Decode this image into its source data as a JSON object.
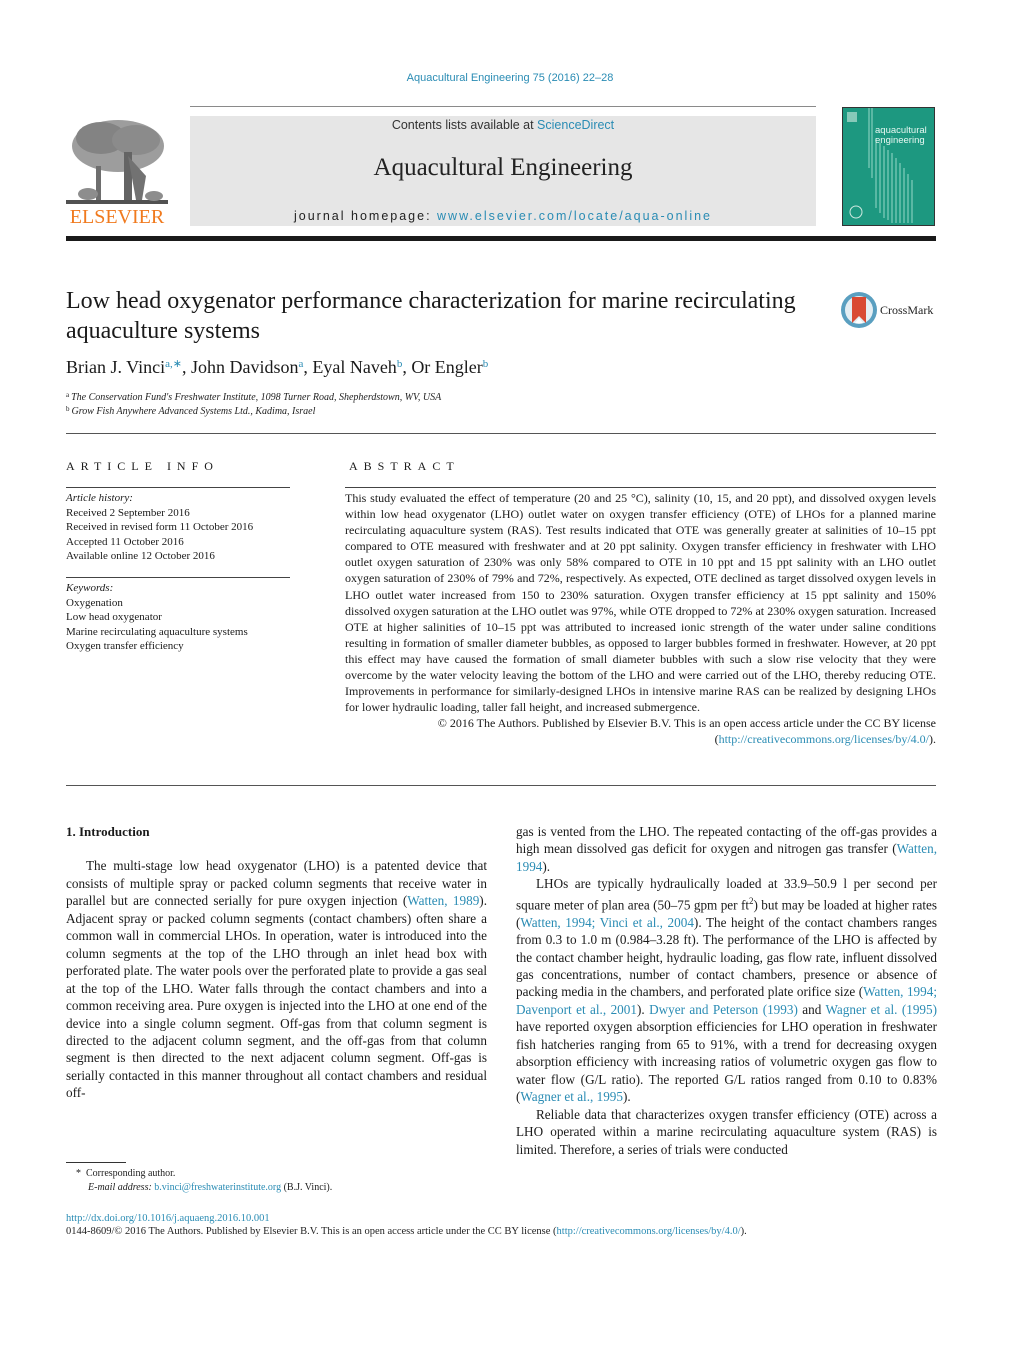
{
  "header": {
    "citation": "Aquacultural Engineering 75 (2016) 22–28",
    "contents_prefix": "Contents lists available at ",
    "contents_link": "ScienceDirect",
    "journal_name": "Aquacultural Engineering",
    "homepage_prefix": "journal homepage: ",
    "homepage_link": "www.elsevier.com/locate/aqua-online",
    "publisher_logo_text": "ELSEVIER",
    "cover_title_line1": "aquacultural",
    "cover_title_line2": "engineering",
    "colors": {
      "link": "#2a8cb4",
      "elsevier_orange": "#f07a1e",
      "cover_teal": "#1d9880"
    }
  },
  "article": {
    "title": "Low head oxygenator performance characterization for marine recirculating aquaculture systems",
    "crossmark_label": "CrossMark",
    "authors": [
      {
        "name": "Brian J. Vinci",
        "sup": "a,∗"
      },
      {
        "name": "John Davidson",
        "sup": "a"
      },
      {
        "name": "Eyal Naveh",
        "sup": "b"
      },
      {
        "name": "Or Engler",
        "sup": "b"
      }
    ],
    "affiliations": [
      {
        "key": "a",
        "text": "The Conservation Fund's Freshwater Institute, 1098 Turner Road, Shepherdstown, WV, USA"
      },
      {
        "key": "b",
        "text": "Grow Fish Anywhere Advanced Systems Ltd., Kadima, Israel"
      }
    ]
  },
  "article_info": {
    "heading": "ARTICLE INFO",
    "history_label": "Article history:",
    "history": [
      "Received 2 September 2016",
      "Received in revised form 11 October 2016",
      "Accepted 11 October 2016",
      "Available online 12 October 2016"
    ],
    "keywords_label": "Keywords:",
    "keywords": [
      "Oxygenation",
      "Low head oxygenator",
      "Marine recirculating aquaculture systems",
      "Oxygen transfer efficiency"
    ]
  },
  "abstract": {
    "heading": "ABSTRACT",
    "text": "This study evaluated the effect of temperature (20 and 25 °C), salinity (10, 15, and 20 ppt), and dissolved oxygen levels within low head oxygenator (LHO) outlet water on oxygen transfer efficiency (OTE) of LHOs for a planned marine recirculating aquaculture system (RAS). Test results indicated that OTE was generally greater at salinities of 10–15 ppt compared to OTE measured with freshwater and at 20 ppt salinity. Oxygen transfer efficiency in freshwater with LHO outlet oxygen saturation of 230% was only 58% compared to OTE in 10 ppt and 15 ppt salinity with an LHO outlet oxygen saturation of 230% of 79% and 72%, respectively. As expected, OTE declined as target dissolved oxygen levels in LHO outlet water increased from 150 to 230% saturation. Oxygen transfer efficiency at 15 ppt salinity and 150% dissolved oxygen saturation at the LHO outlet was 97%, while OTE dropped to 72% at 230% oxygen saturation. Increased OTE at higher salinities of 10–15 ppt was attributed to increased ionic strength of the water under saline conditions resulting in formation of smaller diameter bubbles, as opposed to larger bubbles formed in freshwater. However, at 20 ppt this effect may have caused the formation of small diameter bubbles with such a slow rise velocity that they were overcome by the water velocity leaving the bottom of the LHO and were carried out of the LHO, thereby reducing OTE. Improvements in performance for similarly-designed LHOs in intensive marine RAS can be realized by designing LHOs for lower hydraulic loading, taller fall height, and increased submergence.",
    "copyright": "© 2016 The Authors. Published by Elsevier B.V. This is an open access article under the CC BY license",
    "license_open": "(",
    "license_link": "http://creativecommons.org/licenses/by/4.0/",
    "license_close": ")."
  },
  "body": {
    "section_heading": "1.  Introduction",
    "p1": [
      {
        "t": "The multi-stage low head oxygenator (LHO) is a patented device that consists of multiple spray or packed column segments that receive water in parallel but are connected serially for pure oxygen injection ("
      },
      {
        "link": "Watten, 1989"
      },
      {
        "t": "). Adjacent spray or packed column segments (contact chambers) often share a common wall in commercial LHOs. In operation, water is introduced into the column segments at the top of the LHO through an inlet head box with perforated plate. The water pools over the perforated plate to provide a gas seal at the top of the LHO. Water falls through the contact chambers and into a common receiving area. Pure oxygen is injected into the LHO at one end of the device into a single column segment. Off-gas from that column segment is directed to the adjacent column segment, and the off-gas from that column segment is then directed to the next adjacent column segment. Off-gas is serially contacted in this manner throughout all contact chambers and residual off-"
      }
    ],
    "p1_cont": [
      {
        "t": "gas is vented from the LHO. The repeated contacting of the off-gas provides a high mean dissolved gas deficit for oxygen and nitrogen gas transfer ("
      },
      {
        "link": "Watten, 1994"
      },
      {
        "t": ")."
      }
    ],
    "p2": [
      {
        "t": "LHOs are typically hydraulically loaded at 33.9–50.9 l per second per square meter of plan area (50–75 gpm per ft"
      },
      {
        "sup": "2"
      },
      {
        "t": ") but may be loaded at higher rates ("
      },
      {
        "link": "Watten, 1994; Vinci et al., 2004"
      },
      {
        "t": "). The height of the contact chambers ranges from 0.3 to 1.0 m (0.984–3.28 ft). The performance of the LHO is affected by the contact chamber height, hydraulic loading, gas flow rate, influent dissolved gas concentrations, number of contact chambers, presence or absence of packing media in the chambers, and perforated plate orifice size ("
      },
      {
        "link": "Watten, 1994; Davenport et al., 2001"
      },
      {
        "t": "). "
      },
      {
        "link": "Dwyer and Peterson (1993)"
      },
      {
        "t": " and "
      },
      {
        "link": "Wagner et al. (1995)"
      },
      {
        "t": " have reported oxygen absorption efficiencies for LHO operation in freshwater fish hatcheries ranging from 65 to 91%, with a trend for decreasing oxygen absorption efficiency with increasing ratios of volumetric oxygen gas flow to water flow (G/L ratio). The reported G/L ratios ranged from 0.10 to 0.83% ("
      },
      {
        "link": "Wagner et al., 1995"
      },
      {
        "t": ")."
      }
    ],
    "p3": [
      {
        "t": "Reliable data that characterizes oxygen transfer efficiency (OTE) across a LHO operated within a marine recirculating aquaculture system (RAS) is limited. Therefore, a series of trials were conducted"
      }
    ]
  },
  "footnote": {
    "marker": "*",
    "corresponding": "Corresponding author.",
    "email_label": "E-mail address:",
    "email": "b.vinci@freshwaterinstitute.org",
    "email_suffix": " (B.J. Vinci)."
  },
  "footer": {
    "doi": "http://dx.doi.org/10.1016/j.aquaeng.2016.10.001",
    "issn_text": "0144-8609/© 2016 The Authors. Published by Elsevier B.V. This is an open access article under the CC BY license (",
    "license_link": "http://creativecommons.org/licenses/by/4.0/",
    "issn_close": ")."
  }
}
